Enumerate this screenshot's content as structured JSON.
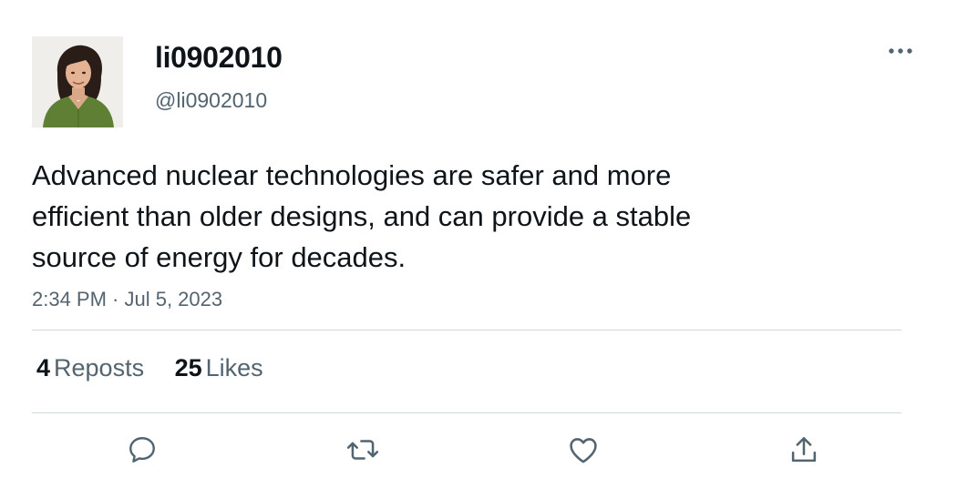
{
  "author": {
    "display_name": "li0902010",
    "handle": "@li0902010",
    "avatar_alt": "profile photo"
  },
  "tweet": {
    "text_lines": [
      "Advanced nuclear technologies are safer and more",
      "efficient than older designs, and can provide a stable",
      "source of energy for decades."
    ],
    "timestamp": "2:34 PM · Jul 5, 2023"
  },
  "stats": {
    "reposts_count": "4",
    "reposts_label": "Reposts",
    "likes_count": "25",
    "likes_label": "Likes"
  },
  "actions": [
    "reply-icon",
    "repost-icon",
    "like-icon",
    "share-icon"
  ],
  "colors": {
    "text": "#0f1419",
    "secondary": "#536471",
    "divider": "#cfd9de"
  }
}
